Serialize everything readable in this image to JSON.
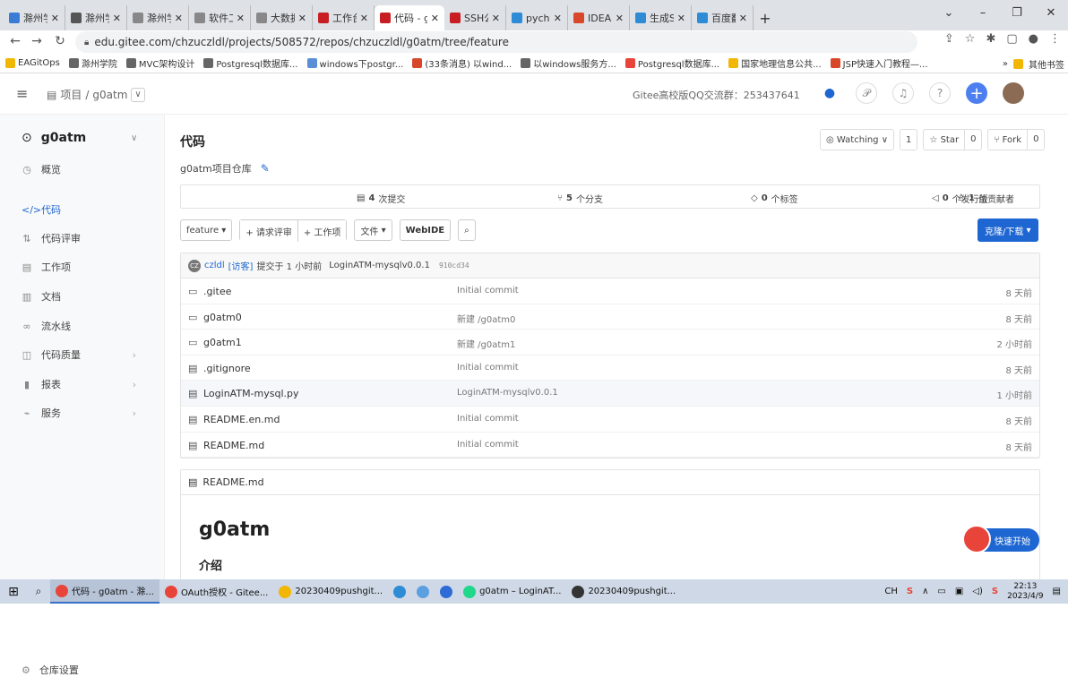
{
  "browser": {
    "tabs": [
      {
        "label": "滁州学院",
        "color": "#3a7bd5",
        "active": false
      },
      {
        "label": "滁州学院",
        "color": "#555555",
        "active": false
      },
      {
        "label": "滁州学院",
        "color": "#888888",
        "active": false
      },
      {
        "label": "软件工程",
        "color": "#888888",
        "active": false
      },
      {
        "label": "大数据可",
        "color": "#888888",
        "active": false
      },
      {
        "label": "工作台",
        "color": "#c71d23",
        "active": false
      },
      {
        "label": "代码 - g",
        "color": "#c71d23",
        "active": true
      },
      {
        "label": "SSH公钥",
        "color": "#c71d23",
        "active": false
      },
      {
        "label": "pycharm",
        "color": "#2e8bd6",
        "active": false
      },
      {
        "label": "IDEA与",
        "color": "#d9472b",
        "active": false
      },
      {
        "label": "生成SSH",
        "color": "#2e8bd6",
        "active": false
      },
      {
        "label": "百度翻译",
        "color": "#2e8bd6",
        "active": false
      }
    ],
    "url": "edu.gitee.com/chzuczldl/projects/508572/repos/chzuczldl/g0atm/tree/feature",
    "bookmarks": [
      {
        "label": "EAGitOps",
        "color": "#f2b705"
      },
      {
        "label": "滁州学院",
        "color": "#666666"
      },
      {
        "label": "MVC架构设计",
        "color": "#666666"
      },
      {
        "label": "Postgresql数据库...",
        "color": "#666666"
      },
      {
        "label": "windows下postgr...",
        "color": "#5a8fd8"
      },
      {
        "label": "(33条消息) 以wind...",
        "color": "#d9472b"
      },
      {
        "label": "以windows服务方...",
        "color": "#666666"
      },
      {
        "label": "Postgresql数据库...",
        "color": "#e8443a"
      },
      {
        "label": "国家地理信息公共...",
        "color": "#f2b705"
      },
      {
        "label": "JSP快速入门教程—...",
        "color": "#d9472b"
      }
    ],
    "bookmarks_more": "»",
    "bookmarks_other": "其他书签"
  },
  "topbar": {
    "crumb_root": "项目",
    "crumb_sep": "/",
    "crumb_repo": "g0atm",
    "qq_group": "Gitee高校版QQ交流群：253437641"
  },
  "sidebar": {
    "repo_name": "g0atm",
    "items": [
      {
        "label": "概览",
        "icon": "◷",
        "active": false,
        "arrow": false
      },
      {
        "label": "代码",
        "icon": "</>",
        "active": true,
        "arrow": false
      },
      {
        "label": "代码评审",
        "icon": "⇅",
        "active": false,
        "arrow": false
      },
      {
        "label": "工作项",
        "icon": "▤",
        "active": false,
        "arrow": false
      },
      {
        "label": "文档",
        "icon": "▥",
        "active": false,
        "arrow": false
      },
      {
        "label": "流水线",
        "icon": "∞",
        "active": false,
        "arrow": false
      },
      {
        "label": "代码质量",
        "icon": "◫",
        "active": false,
        "arrow": true
      },
      {
        "label": "报表",
        "icon": "▮",
        "active": false,
        "arrow": true
      },
      {
        "label": "服务",
        "icon": "⌁",
        "active": false,
        "arrow": true
      }
    ],
    "settings_label": "仓库设置"
  },
  "main": {
    "title": "代码",
    "description": "g0atm项目仓库",
    "watching_label": "Watching",
    "watching_count": "1",
    "star_label": "Star",
    "star_count": "0",
    "fork_label": "Fork",
    "fork_count": "0",
    "stats": {
      "commits": "4",
      "commits_label": "次提交",
      "branches": "5",
      "branches_label": "个分支",
      "tags": "0",
      "tags_label": "个标签",
      "releases": "0",
      "releases_label": "个发行版",
      "contributors": "1",
      "contributors_label": "位贡献者"
    },
    "toolbar": {
      "branch": "feature",
      "pull_request": "+ 请求评审",
      "work_item": "+ 工作项",
      "file": "文件",
      "webide": "WebIDE"
    },
    "clone_label": "克隆/下载",
    "commit": {
      "avatar": "CZ",
      "author": "czldl",
      "guest": "[访客]",
      "text": "提交于 1 小时前",
      "message": "LoginATM-mysqlv0.0.1",
      "hash": "910cd34"
    },
    "files": [
      {
        "type": "folder",
        "name": ".gitee",
        "message": "Initial commit",
        "time": "8 天前"
      },
      {
        "type": "folder",
        "name": "g0atm0",
        "message": "新建 /g0atm0",
        "time": "8 天前"
      },
      {
        "type": "folder",
        "name": "g0atm1",
        "message": "新建 /g0atm1",
        "time": "2 小时前"
      },
      {
        "type": "file",
        "name": ".gitignore",
        "message": "Initial commit",
        "time": "8 天前"
      },
      {
        "type": "file",
        "name": "LoginATM-mysql.py",
        "message": "LoginATM-mysqlv0.0.1",
        "time": "1 小时前"
      },
      {
        "type": "file",
        "name": "README.en.md",
        "message": "Initial commit",
        "time": "8 天前"
      },
      {
        "type": "file",
        "name": "README.md",
        "message": "Initial commit",
        "time": "8 天前"
      }
    ],
    "readme": {
      "filename": "README.md",
      "heading": "g0atm",
      "subheading": "介绍"
    },
    "quick_start": "快速开始"
  },
  "taskbar": {
    "apps": [
      {
        "label": "代码 - g0atm - 滁...",
        "color": "#e8443a",
        "active": true
      },
      {
        "label": "OAuth授权 - Gitee...",
        "color": "#e8443a",
        "active": false
      },
      {
        "label": "20230409pushgit...",
        "color": "#f2b705",
        "active": false
      },
      {
        "label": "",
        "color": "#2e8bd6",
        "active": false
      },
      {
        "label": "",
        "color": "#5aa0e0",
        "active": false
      },
      {
        "label": "",
        "color": "#2e6bd6",
        "active": false
      },
      {
        "label": "g0atm – LoginAT...",
        "color": "#21d789",
        "active": false
      },
      {
        "label": "20230409pushgit...",
        "color": "#333333",
        "active": false
      }
    ],
    "ime": "CH",
    "time": "22:13",
    "date": "2023/4/9"
  }
}
